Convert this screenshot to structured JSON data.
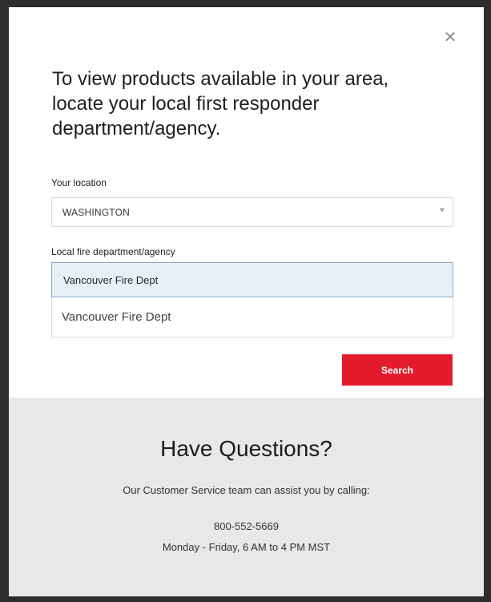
{
  "modal": {
    "close_symbol": "✕",
    "title": "To view products available in your area, locate your local first responder department/agency.",
    "location": {
      "label": "Your location",
      "selected_value": "WASHINGTON"
    },
    "agency": {
      "label": "Local fire department/agency",
      "input_value": "Vancouver Fire Dept",
      "suggestions": [
        "Vancouver Fire Dept"
      ]
    },
    "search_button_label": "Search"
  },
  "questions": {
    "title": "Have Questions?",
    "text": "Our Customer Service team can assist you by calling:",
    "phone": "800-552-5669",
    "hours": "Monday - Friday, 6 AM to 4 PM MST"
  },
  "colors": {
    "accent": "#e31b2d",
    "panel_background": "#e8e8e8",
    "input_highlight": "#e7eff9"
  },
  "icons": {
    "close": "close-icon",
    "dropdown": "chevron-down-icon"
  }
}
